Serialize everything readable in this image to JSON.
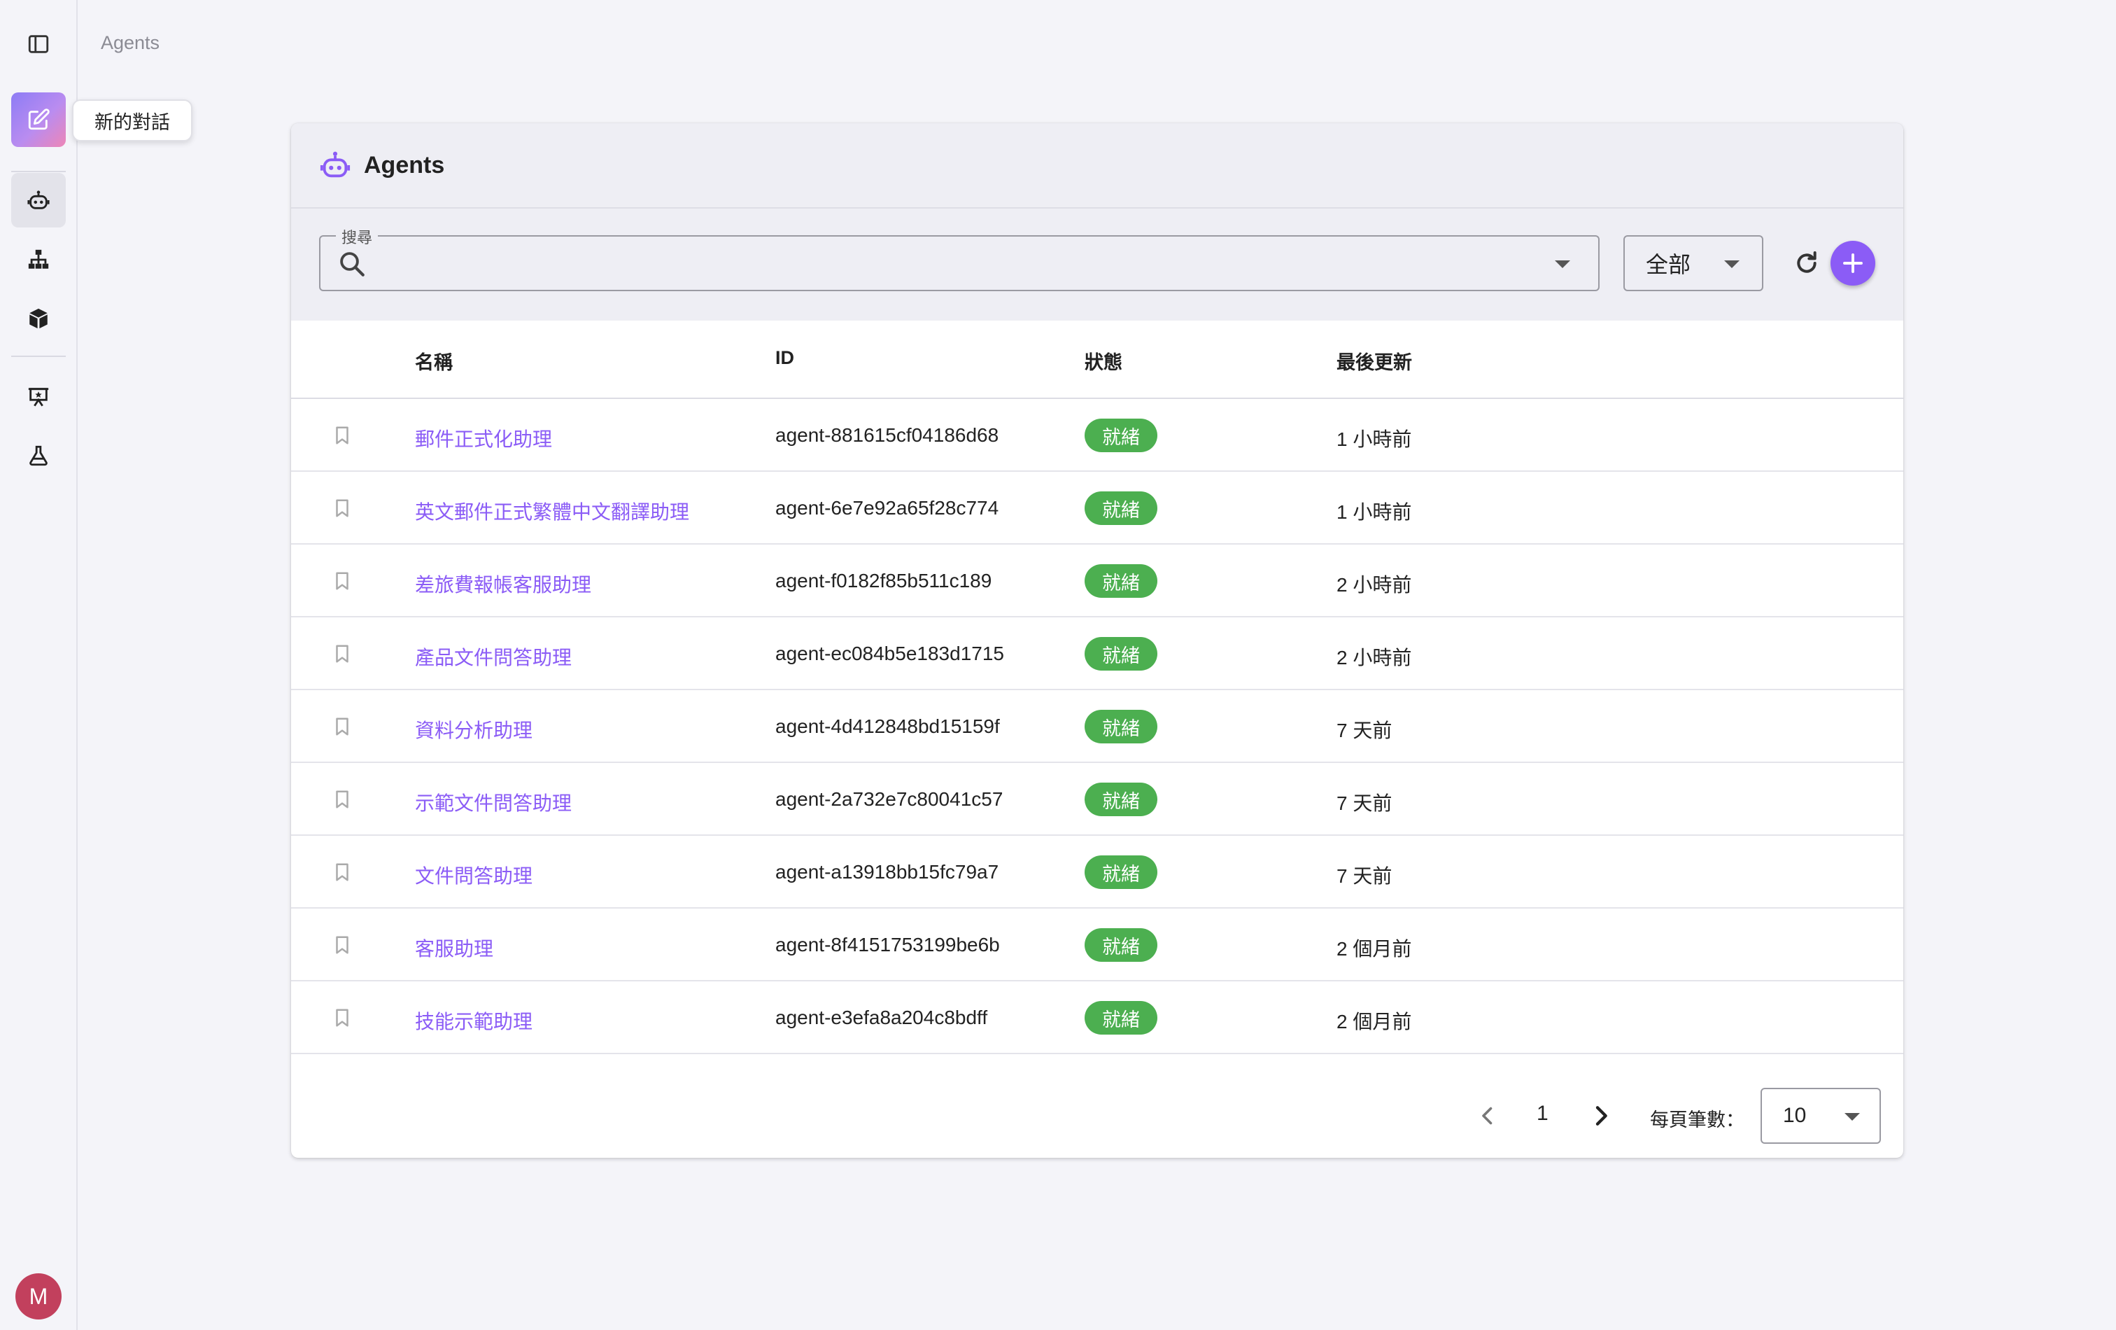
{
  "sidebar": {
    "tooltip": "新的對話",
    "avatar_initial": "M"
  },
  "breadcrumb": "Agents",
  "card": {
    "title": "Agents"
  },
  "search": {
    "label": "搜尋",
    "value": "",
    "placeholder": ""
  },
  "filter": {
    "selected": "全部"
  },
  "table": {
    "columns": [
      "名稱",
      "ID",
      "狀態",
      "最後更新"
    ],
    "rows": [
      {
        "name": "郵件正式化助理",
        "id": "agent-881615cf04186d68",
        "status": "就緒",
        "updated": "1 小時前"
      },
      {
        "name": "英文郵件正式繁體中文翻譯助理",
        "id": "agent-6e7e92a65f28c774",
        "status": "就緒",
        "updated": "1 小時前"
      },
      {
        "name": "差旅費報帳客服助理",
        "id": "agent-f0182f85b511c189",
        "status": "就緒",
        "updated": "2 小時前"
      },
      {
        "name": "產品文件問答助理",
        "id": "agent-ec084b5e183d1715",
        "status": "就緒",
        "updated": "2 小時前"
      },
      {
        "name": "資料分析助理",
        "id": "agent-4d412848bd15159f",
        "status": "就緒",
        "updated": "7 天前"
      },
      {
        "name": "示範文件問答助理",
        "id": "agent-2a732e7c80041c57",
        "status": "就緒",
        "updated": "7 天前"
      },
      {
        "name": "文件問答助理",
        "id": "agent-a13918bb15fc79a7",
        "status": "就緒",
        "updated": "7 天前"
      },
      {
        "name": "客服助理",
        "id": "agent-8f4151753199be6b",
        "status": "就緒",
        "updated": "2 個月前"
      },
      {
        "name": "技能示範助理",
        "id": "agent-e3efa8a204c8bdff",
        "status": "就緒",
        "updated": "2 個月前"
      }
    ]
  },
  "pagination": {
    "current_page": "1",
    "per_page_label": "每頁筆數：",
    "per_page_value": "10"
  },
  "colors": {
    "accent": "#8b5cf6",
    "status_ready": "#4caf50",
    "avatar": "#c2405d"
  }
}
